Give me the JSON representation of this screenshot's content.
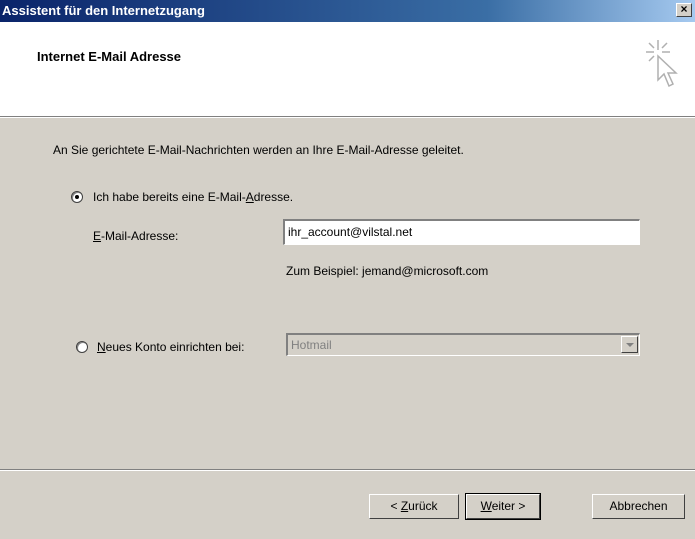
{
  "window": {
    "title": "Assistent für den Internetzugang",
    "close_label": "×"
  },
  "header": {
    "title": "Internet E-Mail Adresse"
  },
  "body": {
    "intro": "An Sie gerichtete E-Mail-Nachrichten werden an Ihre E-Mail-Adresse geleitet.",
    "radio_existing": {
      "label_pre": "Ich habe bereits eine E-Mail-",
      "label_u": "A",
      "label_post": "dresse.",
      "checked": true
    },
    "email": {
      "label_u": "E",
      "label_post": "-Mail-Adresse:",
      "value": "ihr_account@vilstal.net"
    },
    "example": "Zum Beispiel: jemand@microsoft.com",
    "radio_new": {
      "label_u": "N",
      "label_post": "eues Konto einrichten bei:",
      "checked": false
    },
    "provider_select": {
      "value": "Hotmail"
    }
  },
  "buttons": {
    "back": {
      "pre": "< ",
      "u": "Z",
      "post": "urück"
    },
    "next": {
      "u": "W",
      "post": "eiter >"
    },
    "cancel": "Abbrechen"
  }
}
